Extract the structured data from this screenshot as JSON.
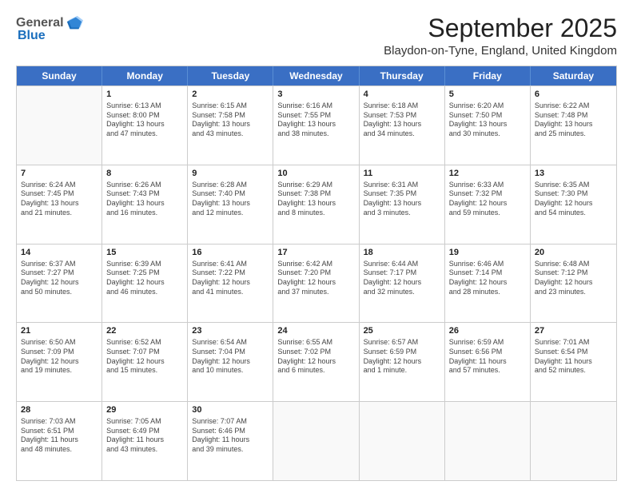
{
  "logo": {
    "general": "General",
    "blue": "Blue"
  },
  "title": "September 2025",
  "subtitle": "Blaydon-on-Tyne, England, United Kingdom",
  "header_days": [
    "Sunday",
    "Monday",
    "Tuesday",
    "Wednesday",
    "Thursday",
    "Friday",
    "Saturday"
  ],
  "weeks": [
    [
      {
        "day": "",
        "lines": [],
        "empty": true
      },
      {
        "day": "1",
        "lines": [
          "Sunrise: 6:13 AM",
          "Sunset: 8:00 PM",
          "Daylight: 13 hours",
          "and 47 minutes."
        ]
      },
      {
        "day": "2",
        "lines": [
          "Sunrise: 6:15 AM",
          "Sunset: 7:58 PM",
          "Daylight: 13 hours",
          "and 43 minutes."
        ]
      },
      {
        "day": "3",
        "lines": [
          "Sunrise: 6:16 AM",
          "Sunset: 7:55 PM",
          "Daylight: 13 hours",
          "and 38 minutes."
        ]
      },
      {
        "day": "4",
        "lines": [
          "Sunrise: 6:18 AM",
          "Sunset: 7:53 PM",
          "Daylight: 13 hours",
          "and 34 minutes."
        ]
      },
      {
        "day": "5",
        "lines": [
          "Sunrise: 6:20 AM",
          "Sunset: 7:50 PM",
          "Daylight: 13 hours",
          "and 30 minutes."
        ]
      },
      {
        "day": "6",
        "lines": [
          "Sunrise: 6:22 AM",
          "Sunset: 7:48 PM",
          "Daylight: 13 hours",
          "and 25 minutes."
        ]
      }
    ],
    [
      {
        "day": "7",
        "lines": [
          "Sunrise: 6:24 AM",
          "Sunset: 7:45 PM",
          "Daylight: 13 hours",
          "and 21 minutes."
        ]
      },
      {
        "day": "8",
        "lines": [
          "Sunrise: 6:26 AM",
          "Sunset: 7:43 PM",
          "Daylight: 13 hours",
          "and 16 minutes."
        ]
      },
      {
        "day": "9",
        "lines": [
          "Sunrise: 6:28 AM",
          "Sunset: 7:40 PM",
          "Daylight: 13 hours",
          "and 12 minutes."
        ]
      },
      {
        "day": "10",
        "lines": [
          "Sunrise: 6:29 AM",
          "Sunset: 7:38 PM",
          "Daylight: 13 hours",
          "and 8 minutes."
        ]
      },
      {
        "day": "11",
        "lines": [
          "Sunrise: 6:31 AM",
          "Sunset: 7:35 PM",
          "Daylight: 13 hours",
          "and 3 minutes."
        ]
      },
      {
        "day": "12",
        "lines": [
          "Sunrise: 6:33 AM",
          "Sunset: 7:32 PM",
          "Daylight: 12 hours",
          "and 59 minutes."
        ]
      },
      {
        "day": "13",
        "lines": [
          "Sunrise: 6:35 AM",
          "Sunset: 7:30 PM",
          "Daylight: 12 hours",
          "and 54 minutes."
        ]
      }
    ],
    [
      {
        "day": "14",
        "lines": [
          "Sunrise: 6:37 AM",
          "Sunset: 7:27 PM",
          "Daylight: 12 hours",
          "and 50 minutes."
        ]
      },
      {
        "day": "15",
        "lines": [
          "Sunrise: 6:39 AM",
          "Sunset: 7:25 PM",
          "Daylight: 12 hours",
          "and 46 minutes."
        ]
      },
      {
        "day": "16",
        "lines": [
          "Sunrise: 6:41 AM",
          "Sunset: 7:22 PM",
          "Daylight: 12 hours",
          "and 41 minutes."
        ]
      },
      {
        "day": "17",
        "lines": [
          "Sunrise: 6:42 AM",
          "Sunset: 7:20 PM",
          "Daylight: 12 hours",
          "and 37 minutes."
        ]
      },
      {
        "day": "18",
        "lines": [
          "Sunrise: 6:44 AM",
          "Sunset: 7:17 PM",
          "Daylight: 12 hours",
          "and 32 minutes."
        ]
      },
      {
        "day": "19",
        "lines": [
          "Sunrise: 6:46 AM",
          "Sunset: 7:14 PM",
          "Daylight: 12 hours",
          "and 28 minutes."
        ]
      },
      {
        "day": "20",
        "lines": [
          "Sunrise: 6:48 AM",
          "Sunset: 7:12 PM",
          "Daylight: 12 hours",
          "and 23 minutes."
        ]
      }
    ],
    [
      {
        "day": "21",
        "lines": [
          "Sunrise: 6:50 AM",
          "Sunset: 7:09 PM",
          "Daylight: 12 hours",
          "and 19 minutes."
        ]
      },
      {
        "day": "22",
        "lines": [
          "Sunrise: 6:52 AM",
          "Sunset: 7:07 PM",
          "Daylight: 12 hours",
          "and 15 minutes."
        ]
      },
      {
        "day": "23",
        "lines": [
          "Sunrise: 6:54 AM",
          "Sunset: 7:04 PM",
          "Daylight: 12 hours",
          "and 10 minutes."
        ]
      },
      {
        "day": "24",
        "lines": [
          "Sunrise: 6:55 AM",
          "Sunset: 7:02 PM",
          "Daylight: 12 hours",
          "and 6 minutes."
        ]
      },
      {
        "day": "25",
        "lines": [
          "Sunrise: 6:57 AM",
          "Sunset: 6:59 PM",
          "Daylight: 12 hours",
          "and 1 minute."
        ]
      },
      {
        "day": "26",
        "lines": [
          "Sunrise: 6:59 AM",
          "Sunset: 6:56 PM",
          "Daylight: 11 hours",
          "and 57 minutes."
        ]
      },
      {
        "day": "27",
        "lines": [
          "Sunrise: 7:01 AM",
          "Sunset: 6:54 PM",
          "Daylight: 11 hours",
          "and 52 minutes."
        ]
      }
    ],
    [
      {
        "day": "28",
        "lines": [
          "Sunrise: 7:03 AM",
          "Sunset: 6:51 PM",
          "Daylight: 11 hours",
          "and 48 minutes."
        ]
      },
      {
        "day": "29",
        "lines": [
          "Sunrise: 7:05 AM",
          "Sunset: 6:49 PM",
          "Daylight: 11 hours",
          "and 43 minutes."
        ]
      },
      {
        "day": "30",
        "lines": [
          "Sunrise: 7:07 AM",
          "Sunset: 6:46 PM",
          "Daylight: 11 hours",
          "and 39 minutes."
        ]
      },
      {
        "day": "",
        "lines": [],
        "empty": true
      },
      {
        "day": "",
        "lines": [],
        "empty": true
      },
      {
        "day": "",
        "lines": [],
        "empty": true
      },
      {
        "day": "",
        "lines": [],
        "empty": true
      }
    ]
  ]
}
